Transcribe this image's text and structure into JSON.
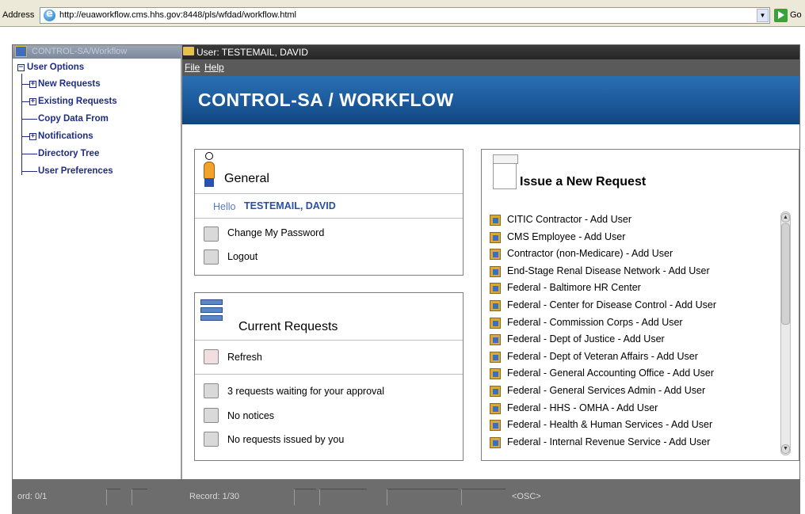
{
  "browser": {
    "address_label": "Address",
    "url": "http://euaworkflow.cms.hhs.gov:8448/pls/wfdad/workflow.html",
    "dropdown_glyph": "▼",
    "go_label": "Go"
  },
  "tree": {
    "title": "CONTROL-SA/Workflow",
    "root_label": "User Options",
    "items": [
      {
        "label": "New Requests"
      },
      {
        "label": "Existing Requests"
      },
      {
        "label": "Copy Data From"
      },
      {
        "label": "Notifications"
      },
      {
        "label": "Directory Tree"
      },
      {
        "label": "User Preferences"
      }
    ]
  },
  "content": {
    "title": "User: TESTEMAIL, DAVID",
    "menu": {
      "file": "File",
      "help": "Help"
    },
    "banner_title": "CONTROL-SA / WORKFLOW"
  },
  "general": {
    "title": "General",
    "hello_prefix": "Hello",
    "user_name": "TESTEMAIL, DAVID",
    "change_password": "Change My Password",
    "logout": "Logout"
  },
  "current_requests": {
    "title": "Current Requests",
    "refresh": "Refresh",
    "waiting": "3 requests waiting for your approval",
    "notices": "No notices",
    "issued": "No requests issued by you"
  },
  "new_request": {
    "title": "Issue a New Request",
    "items": [
      "CITIC Contractor - Add User",
      "CMS Employee - Add User",
      "Contractor (non-Medicare) - Add User",
      "End-Stage Renal Disease Network - Add User",
      "Federal - Baltimore HR Center",
      "Federal - Center for Disease Control - Add User",
      "Federal - Commission Corps - Add User",
      "Federal - Dept of Justice - Add User",
      "Federal - Dept of Veteran Affairs - Add User",
      "Federal - General Accounting Office - Add User",
      "Federal - General Services Admin - Add User",
      "Federal - HHS - OMHA - Add User",
      "Federal - Health & Human Services - Add User",
      "Federal - Internal Revenue Service - Add User"
    ]
  },
  "status": {
    "left_record": "ord: 0/1",
    "record": "Record: 1/30",
    "osc": "<OSC>"
  }
}
